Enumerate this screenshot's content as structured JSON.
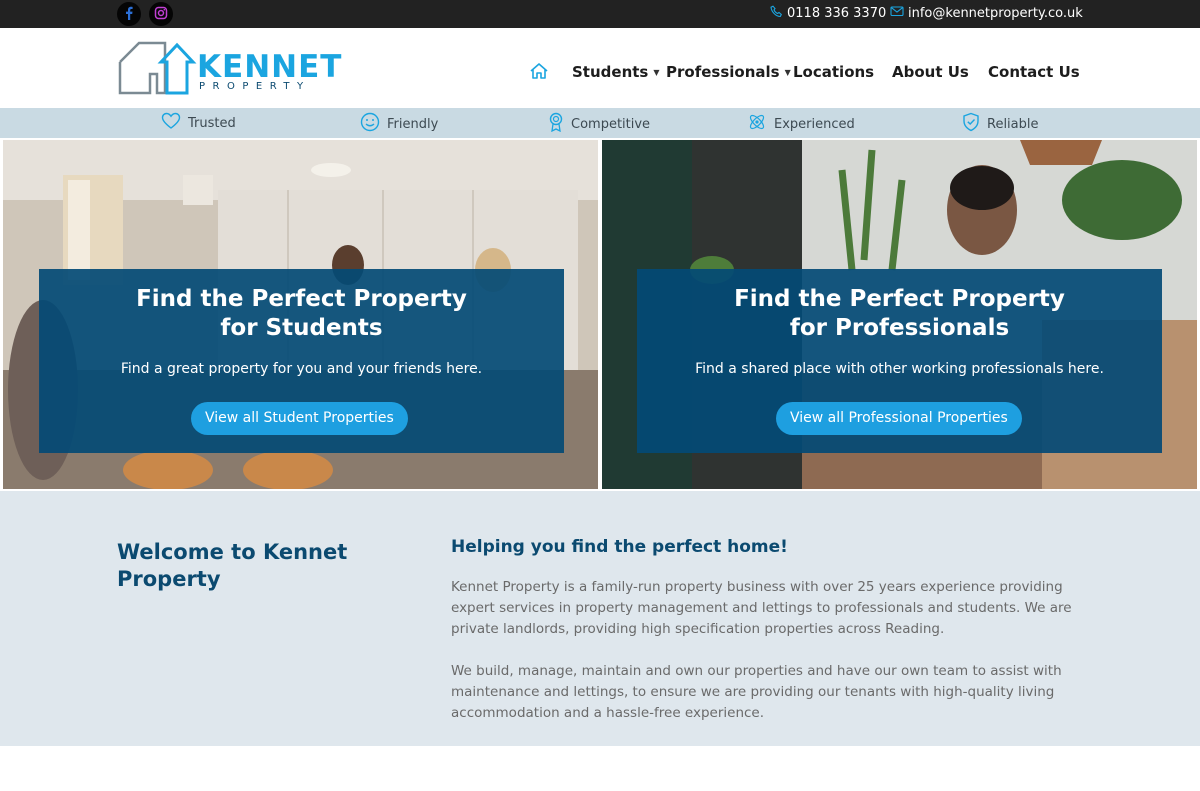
{
  "topbar": {
    "social": [
      {
        "icon": "facebook-icon"
      },
      {
        "icon": "instagram-icon"
      }
    ],
    "phone": "0118 336 3370",
    "email": "info@kennetproperty.co.uk"
  },
  "header": {
    "logo": {
      "word": "KENNET",
      "sub": "PROPERTY"
    },
    "nav": {
      "home_icon": "home-icon",
      "students": "Students",
      "professionals": "Professionals",
      "locations": "Locations",
      "about": "About Us",
      "contact": "Contact Us"
    }
  },
  "values": [
    {
      "label": "Trusted",
      "icon": "heart-icon"
    },
    {
      "label": "Friendly",
      "icon": "smiley-icon"
    },
    {
      "label": "Competitive",
      "icon": "award-icon"
    },
    {
      "label": "Experienced",
      "icon": "atom-icon"
    },
    {
      "label": "Reliable",
      "icon": "shield-check-icon"
    }
  ],
  "hero": {
    "students": {
      "title": "Find the Perfect Property\nfor Students",
      "text": "Find a great property for you and your friends here.",
      "button": "View all Student Properties"
    },
    "professionals": {
      "title": "Find the Perfect Property\nfor Professionals",
      "text": "Find a shared place with other working professionals here.",
      "button": "View all Professional Properties"
    }
  },
  "welcome": {
    "heading": "Welcome to Kennet Property",
    "subheading": "Helping you find the perfect home!",
    "paragraph1": "Kennet Property is a family-run property business with over 25 years experience providing expert services in property management and lettings to professionals and students. We are private landlords, providing high specification properties across Reading.",
    "paragraph2": "We build, manage, maintain and own our properties and have our own team to assist with maintenance and lettings, to ensure we are providing our tenants with high-quality living accommodation and a hassle-free experience."
  },
  "colors": {
    "brand_blue": "#1ba5e0",
    "brand_navy": "#0b4a70",
    "overlay": "#034a75",
    "button": "#1e9fe0",
    "values_strip": "#c9dae3",
    "welcome_bg": "#dfe7ed"
  }
}
